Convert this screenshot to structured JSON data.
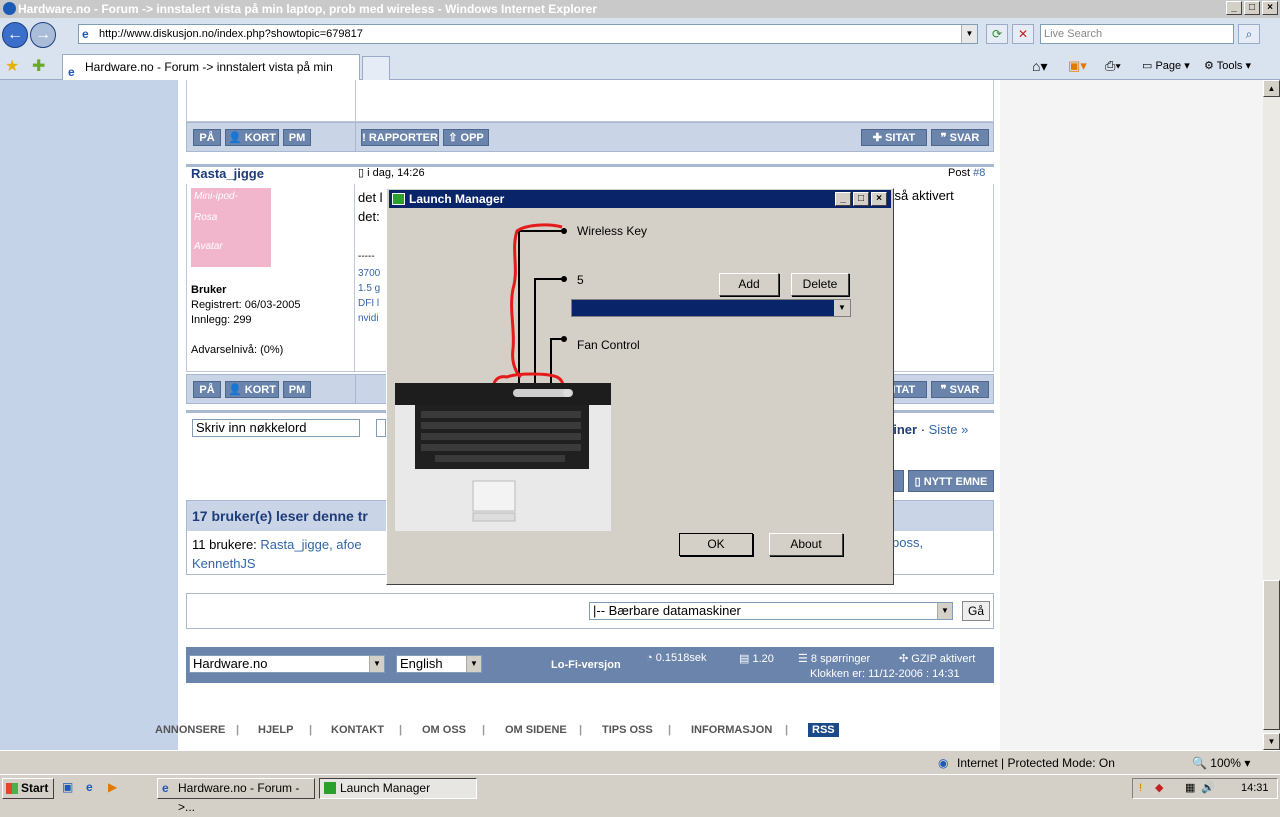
{
  "ie": {
    "title": "Hardware.no - Forum -> innstalert vista på min laptop, prob med wireless - Windows Internet Explorer",
    "url": "http://www.diskusjon.no/index.php?showtopic=679817",
    "search_placeholder": "Live Search",
    "tab_title": "Hardware.no - Forum -> innstalert vista på min laptop...",
    "cmd_page": "Page",
    "cmd_tools": "Tools"
  },
  "forum": {
    "buttons": {
      "pa": "PÅ",
      "kort": "KORT",
      "pm": "PM",
      "rapporter": "RAPPORTER",
      "opp": "OPP",
      "sitat": "SITAT",
      "svar": "SVAR",
      "nytt_emne": "NYTT EMNE"
    },
    "post": {
      "username": "Rasta_jigge",
      "date": "i dag, 14:26",
      "post_label": "Post ",
      "post_number": "#8",
      "avatar_lines": [
        "Mini-ipod-",
        "Rosa",
        "Avatar"
      ],
      "rank": "Bruker",
      "registered": "Registrert: 06/03-2005",
      "posts": "Innlegg: 299",
      "warning": "Advarselnivå: (0%)",
      "text_line1": "det l",
      "text_line2": "det:",
      "text_right": "ltså aktivert",
      "sig_dashes": "-----",
      "sig_lines": [
        "3700",
        "1.5 g",
        "DFI l",
        "nvidi"
      ]
    },
    "search_placeholder": "Skriv inn nøkkelord",
    "pagenav_current": "kiner",
    "pagenav_sep": " · ",
    "pagenav_last": "Siste »",
    "readers": {
      "header": "17 bruker(e) leser denne tr",
      "count_label": "11 brukere: ",
      "users_visible": "Rasta_jigge, afoe",
      "users_right": "boss,",
      "users_line2": "KennethJS"
    },
    "jump_select": "|-- Bærbare datamaskiner",
    "go_label": "Gå",
    "footer": {
      "site_select": "Hardware.no",
      "lang_select": "English",
      "lofi": "Lo-Fi-versjon",
      "time": "0.1518sek",
      "load": "1.20",
      "queries": "8 spørringer",
      "gzip": "GZIP aktivert",
      "clock": "Klokken er: 11/12-2006 : 14:31"
    },
    "bottom_links": [
      "ANNONSERE",
      "HJELP",
      "KONTAKT",
      "OM OSS",
      "OM SIDENE",
      "TIPS OSS",
      "INFORMASJON"
    ],
    "rss": "RSS"
  },
  "dialog": {
    "title": "Launch Manager",
    "label_wireless": "Wireless Key",
    "label_5": "5",
    "label_fan": "Fan Control",
    "add": "Add",
    "delete": "Delete",
    "ok": "OK",
    "about": "About"
  },
  "status": {
    "zone": "Internet | Protected Mode: On",
    "zoom": "100%"
  },
  "taskbar": {
    "start": "Start",
    "task1": "Hardware.no - Forum ->...",
    "task2": "Launch Manager",
    "clock": "14:31"
  },
  "colors": {
    "dialog_title": "#0a246a",
    "forum_button": "#6a84ac",
    "annotation_red": "#e41b1b"
  }
}
